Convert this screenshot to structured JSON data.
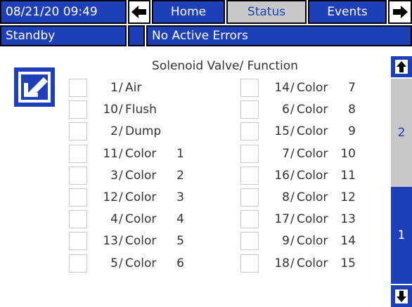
{
  "header": {
    "datetime": "08/21/20 09:49",
    "tabs": [
      "Home",
      "Status",
      "Events"
    ],
    "active_tab": "Status",
    "left_arrow_icon": "left-arrow-icon",
    "right_arrow_icon": "right-arrow-icon"
  },
  "statusbar": {
    "mode": "Standby",
    "message": "No Active Errors"
  },
  "main": {
    "title": "Solenoid Valve/ Function",
    "edit_icon": "edit-icon",
    "left_column": [
      {
        "num": "1",
        "func": "Air",
        "color": ""
      },
      {
        "num": "10",
        "func": "Flush",
        "color": ""
      },
      {
        "num": "2",
        "func": "Dump",
        "color": ""
      },
      {
        "num": "11",
        "func": "Color",
        "color": "1"
      },
      {
        "num": "3",
        "func": "Color",
        "color": "2"
      },
      {
        "num": "12",
        "func": "Color",
        "color": "3"
      },
      {
        "num": "4",
        "func": "Color",
        "color": "4"
      },
      {
        "num": "13",
        "func": "Color",
        "color": "5"
      },
      {
        "num": "5",
        "func": "Color",
        "color": "6"
      }
    ],
    "right_column": [
      {
        "num": "14",
        "func": "Color",
        "color": "7"
      },
      {
        "num": "6",
        "func": "Color",
        "color": "8"
      },
      {
        "num": "15",
        "func": "Color",
        "color": "9"
      },
      {
        "num": "7",
        "func": "Color",
        "color": "10"
      },
      {
        "num": "16",
        "func": "Color",
        "color": "11"
      },
      {
        "num": "8",
        "func": "Color",
        "color": "12"
      },
      {
        "num": "17",
        "func": "Color",
        "color": "13"
      },
      {
        "num": "9",
        "func": "Color",
        "color": "14"
      },
      {
        "num": "18",
        "func": "Color",
        "color": "15"
      }
    ]
  },
  "pager": {
    "up_icon": "up-arrow-icon",
    "down_icon": "down-arrow-icon",
    "page_2": "2",
    "page_1": "1",
    "active_page": "1"
  },
  "colors": {
    "accent_blue": "#1d3fb8",
    "inactive_gray": "#c8c8c8",
    "checkbox_border": "#c9c9c9"
  }
}
